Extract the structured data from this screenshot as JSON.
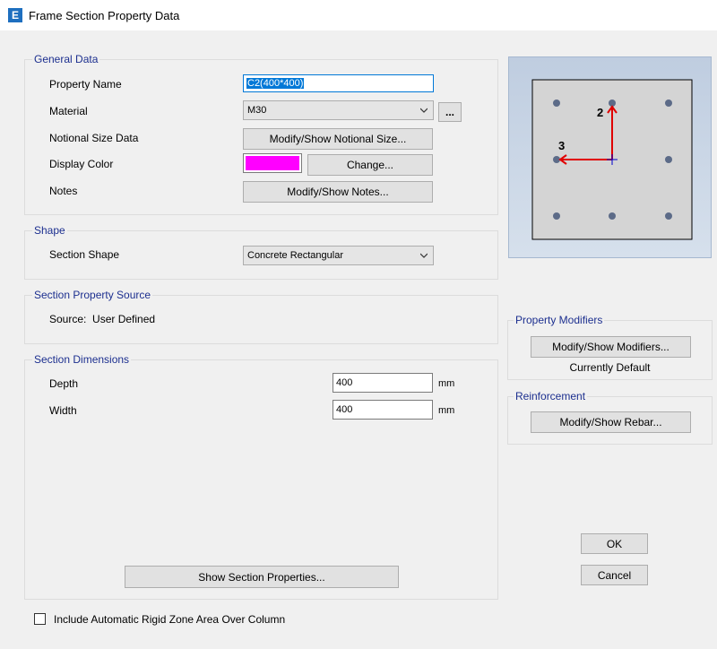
{
  "window": {
    "app_icon": "E",
    "title": "Frame Section Property Data"
  },
  "general_data": {
    "legend": "General Data",
    "property_name_label": "Property Name",
    "property_name_value": "C2(400*400)",
    "material_label": "Material",
    "material_value": "M30",
    "material_browse": "...",
    "notional_label": "Notional Size Data",
    "notional_button": "Modify/Show Notional Size...",
    "color_label": "Display Color",
    "color_value": "#ff00ff",
    "change_button": "Change...",
    "notes_label": "Notes",
    "notes_button": "Modify/Show Notes..."
  },
  "shape": {
    "legend": "Shape",
    "section_shape_label": "Section Shape",
    "section_shape_value": "Concrete Rectangular"
  },
  "source": {
    "legend": "Section Property Source",
    "text": "Source:  User Defined"
  },
  "dimensions": {
    "legend": "Section Dimensions",
    "depth_label": "Depth",
    "depth_value": "400",
    "depth_unit": "mm",
    "width_label": "Width",
    "width_value": "400",
    "width_unit": "mm",
    "show_props_button": "Show Section Properties..."
  },
  "preview": {
    "axis2": "2",
    "axis3": "3"
  },
  "modifiers": {
    "legend": "Property Modifiers",
    "button": "Modify/Show Modifiers...",
    "status": "Currently Default"
  },
  "reinforcement": {
    "legend": "Reinforcement",
    "button": "Modify/Show Rebar..."
  },
  "ok_button": "OK",
  "cancel_button": "Cancel",
  "rigid_zone_label": "Include Automatic Rigid Zone Area Over Column",
  "rigid_zone_checked": false
}
